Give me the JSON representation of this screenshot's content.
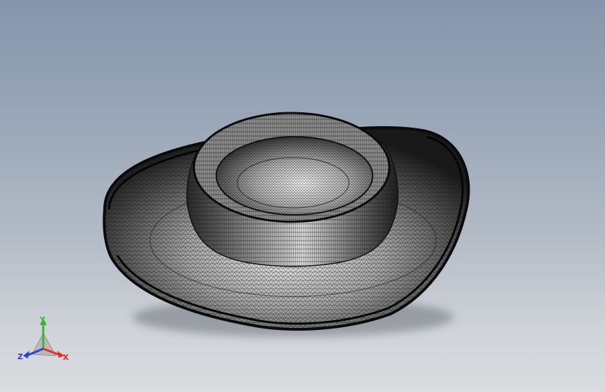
{
  "viewport": {
    "background_top": "#8595ab",
    "background_bottom": "#dadcdf",
    "display_style": "wireframe-mesh"
  },
  "model": {
    "icon": "hat-mesh-model",
    "mesh_color": "#111111",
    "surface_color": "#c9c9c9"
  },
  "triad": {
    "x_label": "X",
    "y_label": "Y",
    "z_label": "Z",
    "x_color": "#e0302c",
    "y_color": "#3cb33c",
    "z_color": "#2c3fd6"
  }
}
